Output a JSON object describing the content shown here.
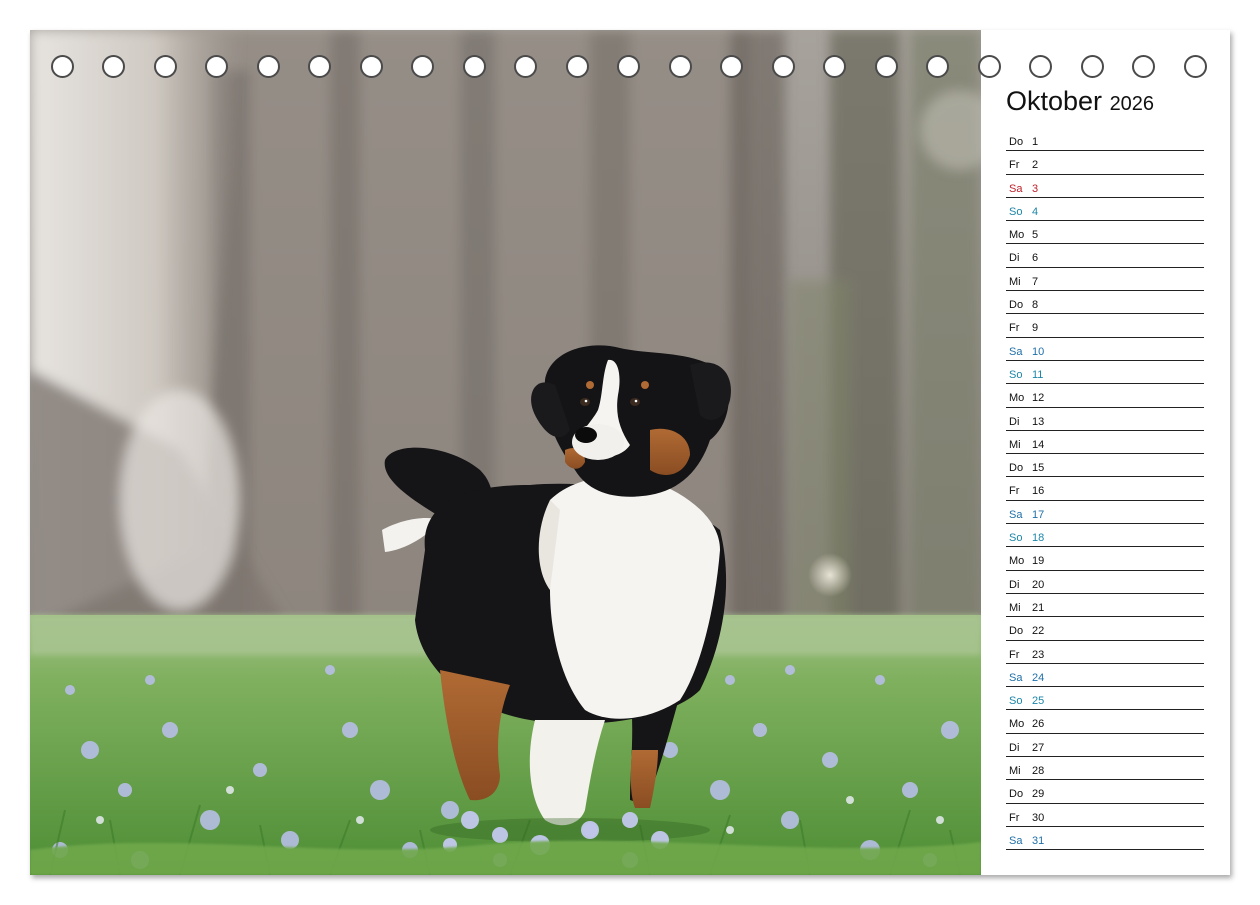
{
  "calendar": {
    "month": "Oktober",
    "year": "2026",
    "days": [
      {
        "wd": "Do",
        "n": "1",
        "type": "normal"
      },
      {
        "wd": "Fr",
        "n": "2",
        "type": "normal"
      },
      {
        "wd": "Sa",
        "n": "3",
        "type": "holiday"
      },
      {
        "wd": "So",
        "n": "4",
        "type": "sun"
      },
      {
        "wd": "Mo",
        "n": "5",
        "type": "normal"
      },
      {
        "wd": "Di",
        "n": "6",
        "type": "normal"
      },
      {
        "wd": "Mi",
        "n": "7",
        "type": "normal"
      },
      {
        "wd": "Do",
        "n": "8",
        "type": "normal"
      },
      {
        "wd": "Fr",
        "n": "9",
        "type": "normal"
      },
      {
        "wd": "Sa",
        "n": "10",
        "type": "sat"
      },
      {
        "wd": "So",
        "n": "11",
        "type": "sun"
      },
      {
        "wd": "Mo",
        "n": "12",
        "type": "normal"
      },
      {
        "wd": "Di",
        "n": "13",
        "type": "normal"
      },
      {
        "wd": "Mi",
        "n": "14",
        "type": "normal"
      },
      {
        "wd": "Do",
        "n": "15",
        "type": "normal"
      },
      {
        "wd": "Fr",
        "n": "16",
        "type": "normal"
      },
      {
        "wd": "Sa",
        "n": "17",
        "type": "sat"
      },
      {
        "wd": "So",
        "n": "18",
        "type": "sun"
      },
      {
        "wd": "Mo",
        "n": "19",
        "type": "normal"
      },
      {
        "wd": "Di",
        "n": "20",
        "type": "normal"
      },
      {
        "wd": "Mi",
        "n": "21",
        "type": "normal"
      },
      {
        "wd": "Do",
        "n": "22",
        "type": "normal"
      },
      {
        "wd": "Fr",
        "n": "23",
        "type": "normal"
      },
      {
        "wd": "Sa",
        "n": "24",
        "type": "sat"
      },
      {
        "wd": "So",
        "n": "25",
        "type": "sun"
      },
      {
        "wd": "Mo",
        "n": "26",
        "type": "normal"
      },
      {
        "wd": "Di",
        "n": "27",
        "type": "normal"
      },
      {
        "wd": "Mi",
        "n": "28",
        "type": "normal"
      },
      {
        "wd": "Do",
        "n": "29",
        "type": "normal"
      },
      {
        "wd": "Fr",
        "n": "30",
        "type": "normal"
      },
      {
        "wd": "Sa",
        "n": "31",
        "type": "sat"
      }
    ]
  },
  "colors": {
    "saturday": "#1f6fa8",
    "sunday": "#1c86a8",
    "holiday": "#c0202a",
    "text": "#111111"
  },
  "photo": {
    "subject": "dog-photo"
  }
}
